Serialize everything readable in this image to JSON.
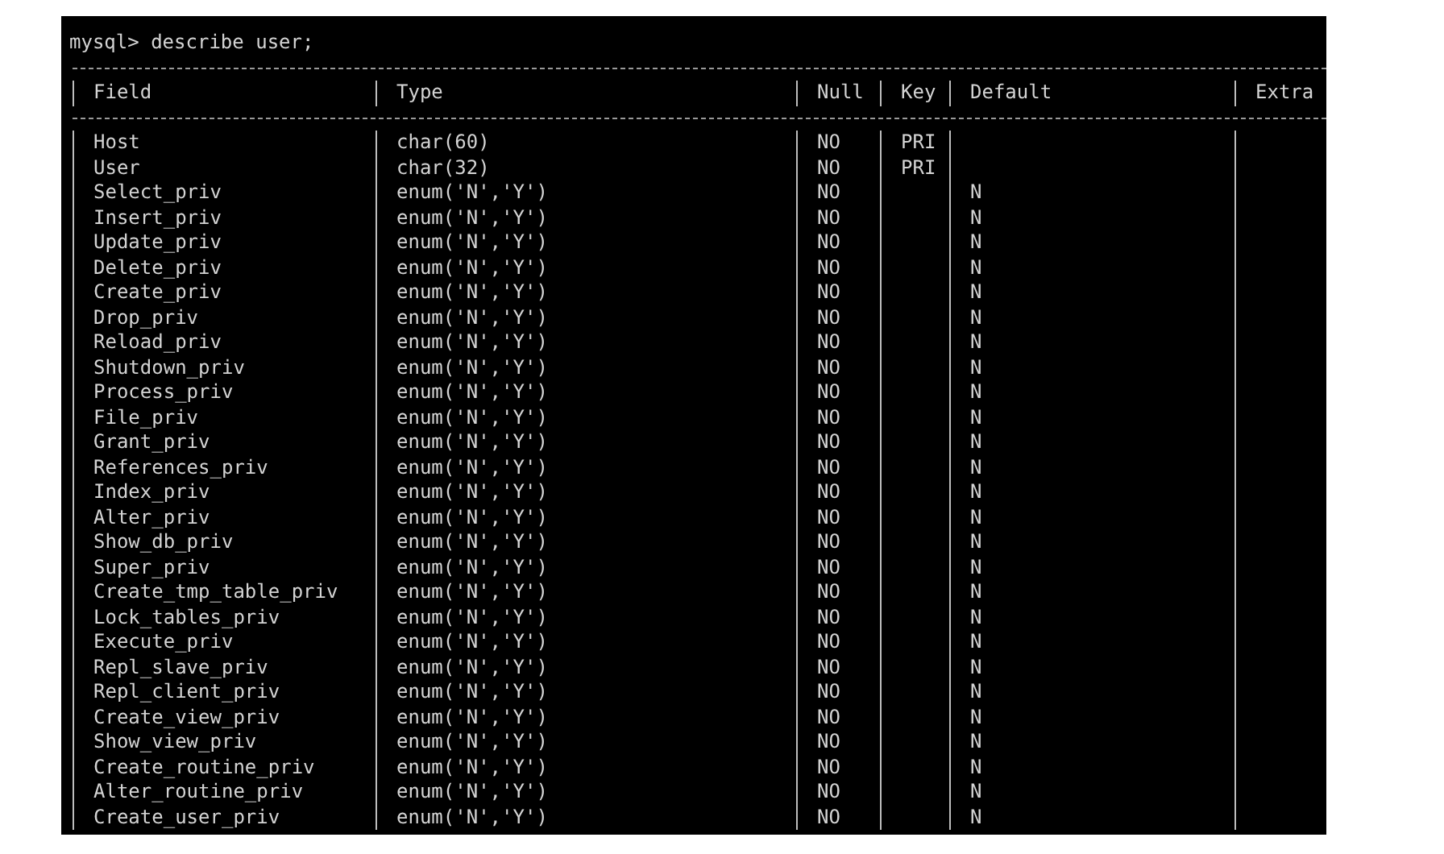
{
  "terminal": {
    "command": "mysql> describe user;",
    "table": {
      "columns": [
        "Field",
        "Type",
        "Null",
        "Key",
        "Default",
        "Extra"
      ],
      "rows": [
        {
          "field": "Host",
          "type": "char(60)",
          "null": "NO",
          "key": "PRI"
        },
        {
          "field": "User",
          "type": "char(32)",
          "null": "NO",
          "key": "PRI"
        },
        {
          "field": "Select_priv",
          "type": "enum('N','Y')",
          "null": "NO",
          "default": "N"
        },
        {
          "field": "Insert_priv",
          "type": "enum('N','Y')",
          "null": "NO",
          "default": "N"
        },
        {
          "field": "Update_priv",
          "type": "enum('N','Y')",
          "null": "NO",
          "default": "N"
        },
        {
          "field": "Delete_priv",
          "type": "enum('N','Y')",
          "null": "NO",
          "default": "N"
        },
        {
          "field": "Create_priv",
          "type": "enum('N','Y')",
          "null": "NO",
          "default": "N"
        },
        {
          "field": "Drop_priv",
          "type": "enum('N','Y')",
          "null": "NO",
          "default": "N"
        },
        {
          "field": "Reload_priv",
          "type": "enum('N','Y')",
          "null": "NO",
          "default": "N"
        },
        {
          "field": "Shutdown_priv",
          "type": "enum('N','Y')",
          "null": "NO",
          "default": "N"
        },
        {
          "field": "Process_priv",
          "type": "enum('N','Y')",
          "null": "NO",
          "default": "N"
        },
        {
          "field": "File_priv",
          "type": "enum('N','Y')",
          "null": "NO",
          "default": "N"
        },
        {
          "field": "Grant_priv",
          "type": "enum('N','Y')",
          "null": "NO",
          "default": "N"
        },
        {
          "field": "References_priv",
          "type": "enum('N','Y')",
          "null": "NO",
          "default": "N"
        },
        {
          "field": "Index_priv",
          "type": "enum('N','Y')",
          "null": "NO",
          "default": "N"
        },
        {
          "field": "Alter_priv",
          "type": "enum('N','Y')",
          "null": "NO",
          "default": "N"
        },
        {
          "field": "Show_db_priv",
          "type": "enum('N','Y')",
          "null": "NO",
          "default": "N"
        },
        {
          "field": "Super_priv",
          "type": "enum('N','Y')",
          "null": "NO",
          "default": "N"
        },
        {
          "field": "Create_tmp_table_priv",
          "type": "enum('N','Y')",
          "null": "NO",
          "default": "N"
        },
        {
          "field": "Lock_tables_priv",
          "type": "enum('N','Y')",
          "null": "NO",
          "default": "N"
        },
        {
          "field": "Execute_priv",
          "type": "enum('N','Y')",
          "null": "NO",
          "default": "N"
        },
        {
          "field": "Repl_slave_priv",
          "type": "enum('N','Y')",
          "null": "NO",
          "default": "N"
        },
        {
          "field": "Repl_client_priv",
          "type": "enum('N','Y')",
          "null": "NO",
          "default": "N"
        },
        {
          "field": "Create_view_priv",
          "type": "enum('N','Y')",
          "null": "NO",
          "default": "N"
        },
        {
          "field": "Show_view_priv",
          "type": "enum('N','Y')",
          "null": "NO",
          "default": "N"
        },
        {
          "field": "Create_routine_priv",
          "type": "enum('N','Y')",
          "null": "NO",
          "default": "N"
        },
        {
          "field": "Alter_routine_priv",
          "type": "enum('N','Y')",
          "null": "NO",
          "default": "N"
        },
        {
          "field": "Create_user_priv",
          "type": "enum('N','Y')",
          "null": "NO",
          "default": "N"
        }
      ]
    }
  }
}
